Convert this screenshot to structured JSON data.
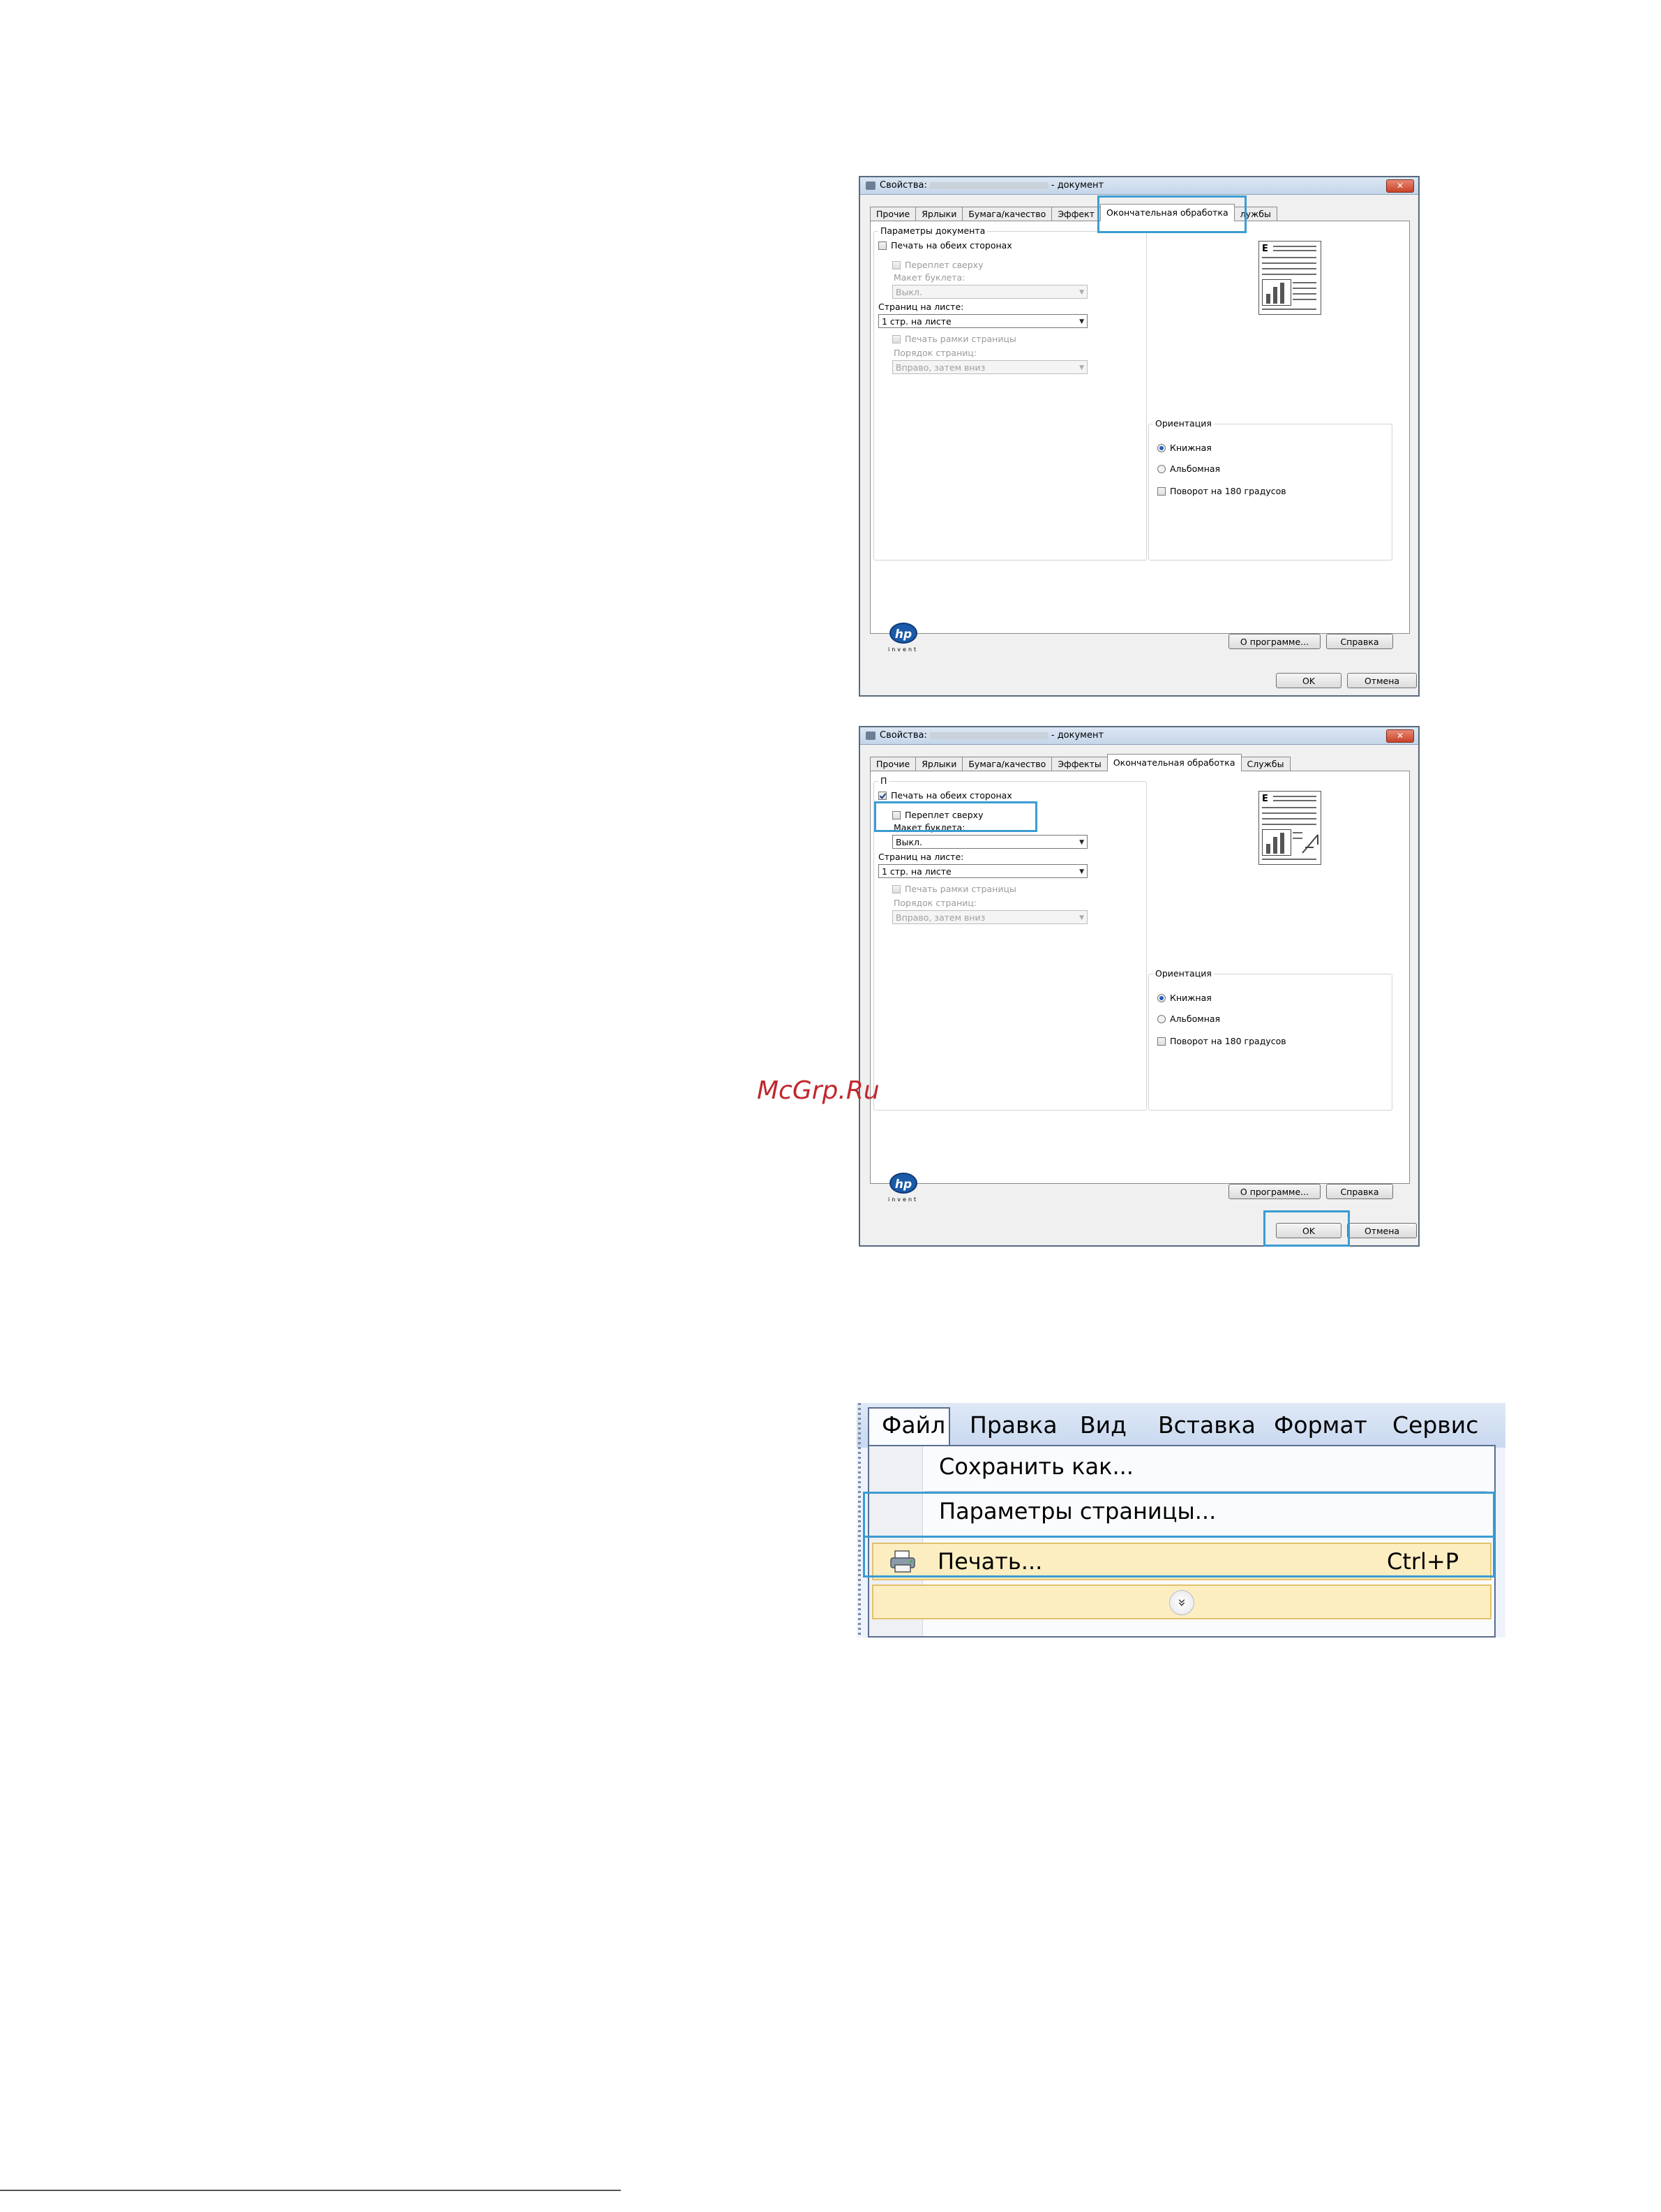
{
  "dialog1": {
    "title_prefix": "Свойства:",
    "title_suffix": "- документ",
    "close_glyph": "✕",
    "tabs": [
      "Прочие",
      "Ярлыки",
      "Бумага/качество",
      "Эффект",
      "Окончательная обработка",
      "лужбы"
    ],
    "group_document": "Параметры документа",
    "duplex": "Печать на обеих сторонах",
    "binding": "Переплет сверху",
    "booklet_label": "Макет буклета:",
    "booklet_value": "Выкл.",
    "pages_label": "Страниц на листе:",
    "pages_value": "1 стр. на листе",
    "borders": "Печать рамки страницы",
    "order_label": "Порядок страниц:",
    "order_value": "Вправо, затем вниз",
    "orientation": "Ориентация",
    "portrait": "Книжная",
    "landscape": "Альбомная",
    "rotate": "Поворот на 180 градусов",
    "about": "О программе...",
    "help": "Справка",
    "ok": "OK",
    "cancel": "Отмена",
    "preview_letter": "E",
    "logo": "hp",
    "invent": "invent"
  },
  "dialog2": {
    "title_prefix": "Свойства:",
    "title_suffix": "- документ",
    "close_glyph": "✕",
    "tabs": [
      "Прочие",
      "Ярлыки",
      "Бумага/качество",
      "Эффекты",
      "Окончательная обработка",
      "Службы"
    ],
    "group_document": "П",
    "duplex": "Печать на обеих сторонах",
    "binding": "Переплет сверху",
    "booklet_label": "Макет буклета:",
    "booklet_value": "Выкл.",
    "pages_label": "Страниц на листе:",
    "pages_value": "1 стр. на листе",
    "borders": "Печать рамки страницы",
    "order_label": "Порядок страниц:",
    "order_value": "Вправо, затем вниз",
    "orientation": "Ориентация",
    "portrait": "Книжная",
    "landscape": "Альбомная",
    "rotate": "Поворот на 180 градусов",
    "about": "О программе...",
    "help": "Справка",
    "ok": "OK",
    "cancel": "Отмена",
    "preview_letter": "E",
    "logo": "hp",
    "invent": "invent"
  },
  "watermark": "McGrp.Ru",
  "menu": {
    "bar": [
      "Файл",
      "Правка",
      "Вид",
      "Вставка",
      "Формат",
      "Сервис"
    ],
    "save_as": "Сохранить как...",
    "page_setup": "Параметры страницы...",
    "print": "Печать...",
    "print_shortcut": "Ctrl+P",
    "expand_glyph": "»"
  },
  "colors": {
    "callout": "#3b9cd2",
    "highlight": "#fdeec2",
    "watermark": "#c0282e"
  }
}
